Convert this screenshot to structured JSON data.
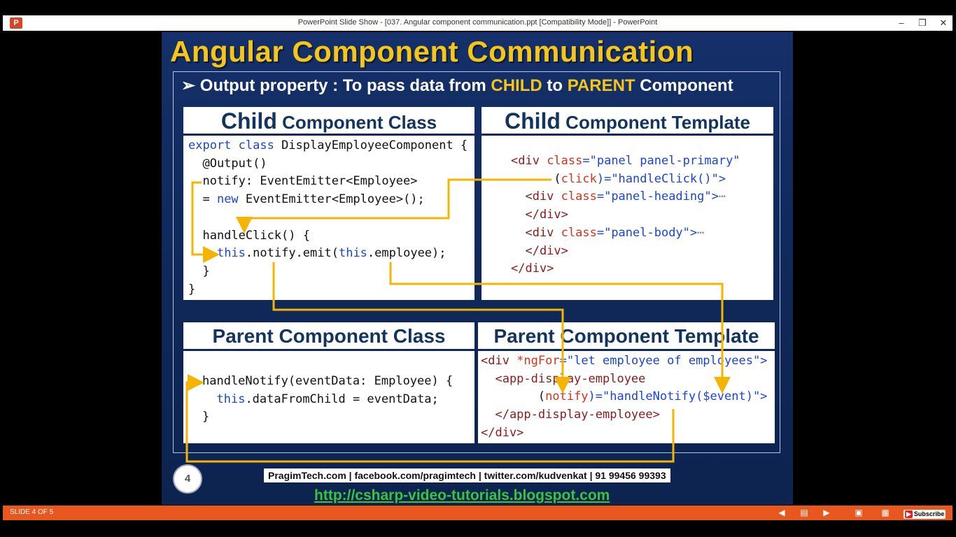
{
  "window": {
    "title": "PowerPoint Slide Show - [037. Angular component communication.ppt [Compatibility Mode]] - PowerPoint",
    "app_icon": "P"
  },
  "slide": {
    "title": "Angular Component Communication",
    "bullet_symbol": "➢",
    "bullet_prefix": "Output property : To pass data from ",
    "bullet_child": "CHILD",
    "bullet_to": " to ",
    "bullet_parent": "PARENT",
    "bullet_suffix": " Component",
    "child_class_head_big": "Child",
    "child_class_head_rest": " Component Class",
    "child_template_head_big": "Child",
    "child_template_head_rest": " Component Template",
    "parent_class_head": "Parent Component Class",
    "parent_template_head": "Parent Component Template",
    "slide_number": "4",
    "footer_contact": "PragimTech.com | facebook.com/pragimtech | twitter.com/kudvenkat | 91 99456 99393",
    "footer_url": "http://csharp-video-tutorials.blogspot.com"
  },
  "code": {
    "child_class": {
      "l1_kw": "export class",
      "l1_rest": " DisplayEmployeeComponent {",
      "l2": "  @Output()",
      "l3": "  notify: EventEmitter<Employee>",
      "l4_pre": "  = ",
      "l4_kw": "new",
      "l4_rest": " EventEmitter<Employee>();",
      "l6": "  handleClick() {",
      "l7_pre": "    ",
      "l7_kw1": "this",
      "l7_mid": ".notify.emit(",
      "l7_kw2": "this",
      "l7_end": ".employee);",
      "l8": "  }",
      "l9": "}"
    },
    "child_template": {
      "l1_tag": "<div ",
      "l1_attr": "class",
      "l1_val": "=\"panel panel-primary\"",
      "l2_pre": "      (",
      "l2_attr": "click",
      "l2_val": ")=\"handleClick()\">",
      "l3_tag": "  <div ",
      "l3_attr": "class",
      "l3_val": "=\"panel-heading\">",
      "l3_dots": "⋯",
      "l4": "  </div>",
      "l5_tag": "  <div ",
      "l5_attr": "class",
      "l5_val": "=\"panel-body\">",
      "l5_dots": "⋯",
      "l6": "  </div>",
      "l7": "</div>"
    },
    "parent_class": {
      "l1": "handleNotify(eventData: Employee) {",
      "l2_pre": "  ",
      "l2_kw": "this",
      "l2_rest": ".dataFromChild = eventData;",
      "l3": "}"
    },
    "parent_template": {
      "l1_tag": "<div ",
      "l1_attr": "*ngFor",
      "l1_val": "=\"let employee of employees\">",
      "l2": "  <app-display-employee",
      "l3_pre": "        (",
      "l3_attr": "notify",
      "l3_val": ")=\"handleNotify($event)\">",
      "l4": "  </app-display-employee>",
      "l5": "</div>"
    }
  },
  "statusbar": {
    "slide_counter": "SLIDE 4 OF 5",
    "subscribe_label": "Subscribe",
    "icons": [
      "prev-icon",
      "notes-icon",
      "next-icon",
      "reading-view-icon",
      "slide-sorter-icon",
      "display-settings-icon",
      "more-icon"
    ]
  },
  "colors": {
    "slide_bg": "#0f2859",
    "title": "#f5c518",
    "arrow": "#f5b400",
    "statusbar": "#e8571e",
    "url": "#39c439"
  }
}
